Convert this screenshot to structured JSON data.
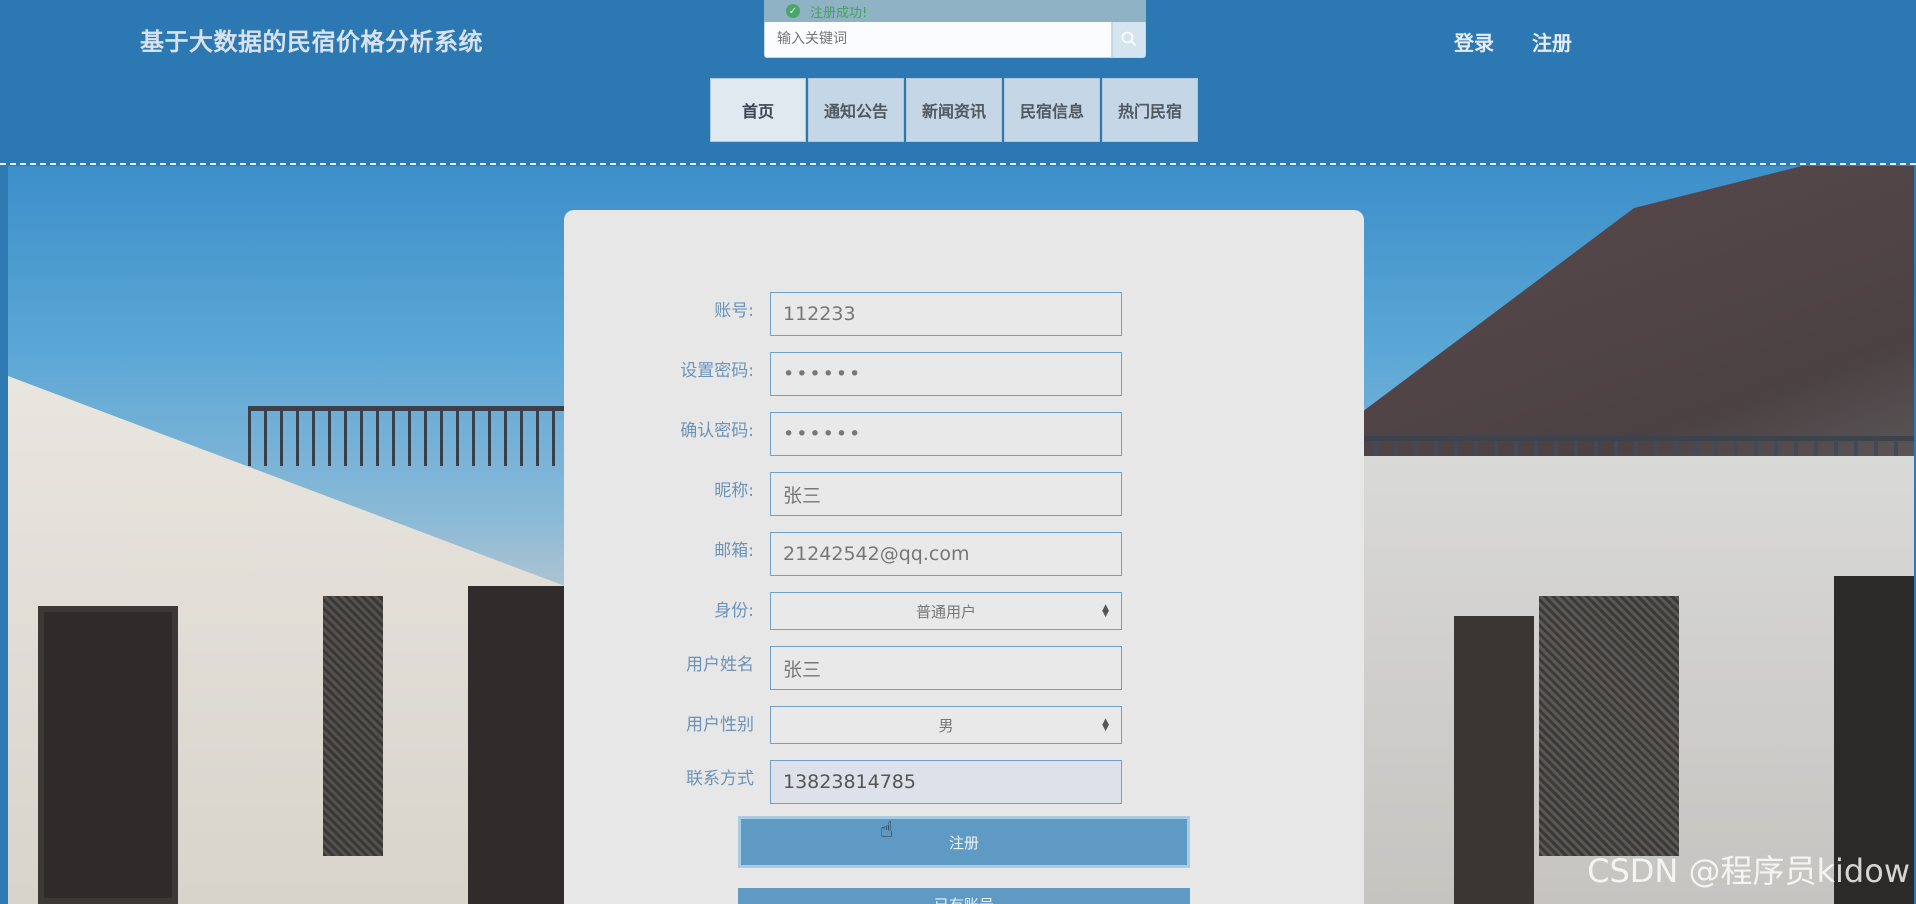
{
  "header": {
    "site_title": "基于大数据的民宿价格分析系统",
    "search_placeholder": "输入关键词",
    "toast": "注册成功!",
    "links": {
      "login": "登录",
      "register": "注册"
    },
    "nav": [
      "首页",
      "通知公告",
      "新闻资讯",
      "民宿信息",
      "热门民宿"
    ]
  },
  "form": {
    "account": {
      "label": "账号:",
      "value": "112233"
    },
    "password": {
      "label": "设置密码:",
      "value": "••••••"
    },
    "confirm_password": {
      "label": "确认密码:",
      "value": "••••••"
    },
    "nickname": {
      "label": "昵称:",
      "value": "张三"
    },
    "email": {
      "label": "邮箱:",
      "value": "21242542@qq.com"
    },
    "identity": {
      "label": "身份:",
      "value": "普通用户"
    },
    "real_name": {
      "label": "用户姓名",
      "value": "张三"
    },
    "gender": {
      "label": "用户性别",
      "value": "男"
    },
    "phone": {
      "label": "联系方式",
      "value": "13823814785"
    },
    "submit_label": "注册",
    "second_label": "已有账号"
  },
  "watermark": "CSDN @程序员kidow",
  "icons": {
    "search": "search-icon",
    "success": "check-circle-icon",
    "select": "updown-arrows-icon"
  }
}
